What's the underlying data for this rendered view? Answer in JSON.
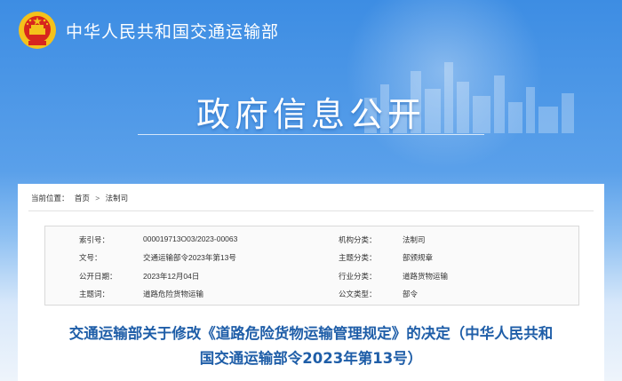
{
  "header": {
    "ministry_name": "中华人民共和国交通运输部",
    "portal_title": "政府信息公开",
    "emblem_icon": "national-emblem-icon"
  },
  "breadcrumb": {
    "label": "当前位置：",
    "items": [
      "首页",
      "法制司"
    ],
    "separator": ">"
  },
  "meta": {
    "rows": [
      {
        "k1": "索引号：",
        "v1": "000019713O03/2023-00063",
        "k2": "机构分类：",
        "v2": "法制司"
      },
      {
        "k1": "文号：",
        "v1": "交通运输部令2023年第13号",
        "k2": "主题分类：",
        "v2": "部颁规章"
      },
      {
        "k1": "公开日期：",
        "v1": "2023年12月04日",
        "k2": "行业分类：",
        "v2": "道路货物运输"
      },
      {
        "k1": "主题词：",
        "v1": "道路危险货物运输",
        "k2": "公文类型：",
        "v2": "部令"
      }
    ]
  },
  "document": {
    "title_line1": "交通运输部关于修改《道路危险货物运输管理规定》的决定（中华人民共和",
    "title_line2": "国交通运输部令2023年第13号）"
  },
  "colors": {
    "banner_blue": "#3d8de3",
    "title_blue": "#1f5ea8",
    "emblem_red": "#d7261e",
    "emblem_gold": "#f4c21b"
  }
}
